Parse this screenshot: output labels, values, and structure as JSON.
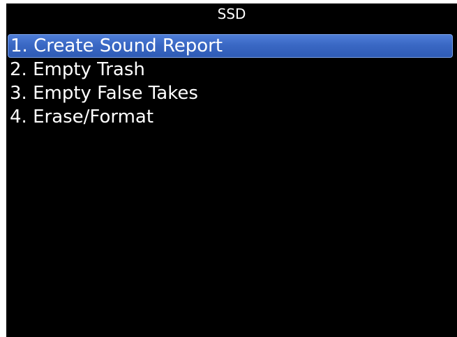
{
  "screen": {
    "title": "SSD",
    "selected_color": "#3a68c4",
    "background_color": "#000000",
    "text_color": "#ffffff"
  },
  "menu": {
    "items": [
      {
        "label": "1. Create Sound Report",
        "selected": true
      },
      {
        "label": "2. Empty Trash",
        "selected": false
      },
      {
        "label": "3. Empty False Takes",
        "selected": false
      },
      {
        "label": "4. Erase/Format",
        "selected": false
      }
    ]
  }
}
